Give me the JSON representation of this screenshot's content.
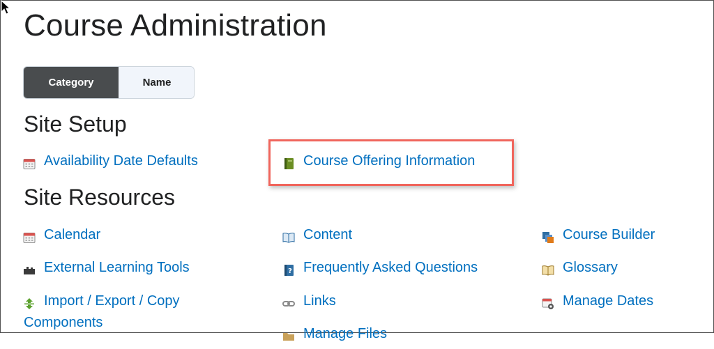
{
  "page": {
    "title": "Course Administration"
  },
  "view_toggle": {
    "category_label": "Category",
    "name_label": "Name"
  },
  "sections": {
    "site_setup": {
      "heading": "Site Setup",
      "tools": [
        {
          "label": "Availability Date Defaults",
          "icon": "calendar-icon"
        },
        {
          "label": "Course Offering Information",
          "icon": "book-icon",
          "highlighted": true
        }
      ]
    },
    "site_resources": {
      "heading": "Site Resources",
      "tools": [
        {
          "label": "Calendar",
          "icon": "calendar-icon"
        },
        {
          "label": "Content",
          "icon": "open-book-icon"
        },
        {
          "label": "Course Builder",
          "icon": "course-builder-icon"
        },
        {
          "label": "External Learning Tools",
          "icon": "puzzle-icon"
        },
        {
          "label": "Frequently Asked Questions",
          "icon": "faq-icon"
        },
        {
          "label": "Glossary",
          "icon": "glossary-book-icon"
        },
        {
          "label": "Import / Export / Copy",
          "label_line2": "Components",
          "icon": "import-export-icon"
        },
        {
          "label": "Links",
          "icon": "link-icon"
        },
        {
          "label": "Manage Dates",
          "icon": "calendar-gear-icon"
        },
        {
          "label": "Manage Files",
          "icon": "folder-icon"
        }
      ]
    }
  },
  "colors": {
    "link": "#006fbf",
    "highlight_border": "#f0655c",
    "toggle_active_bg": "#494c4e"
  }
}
